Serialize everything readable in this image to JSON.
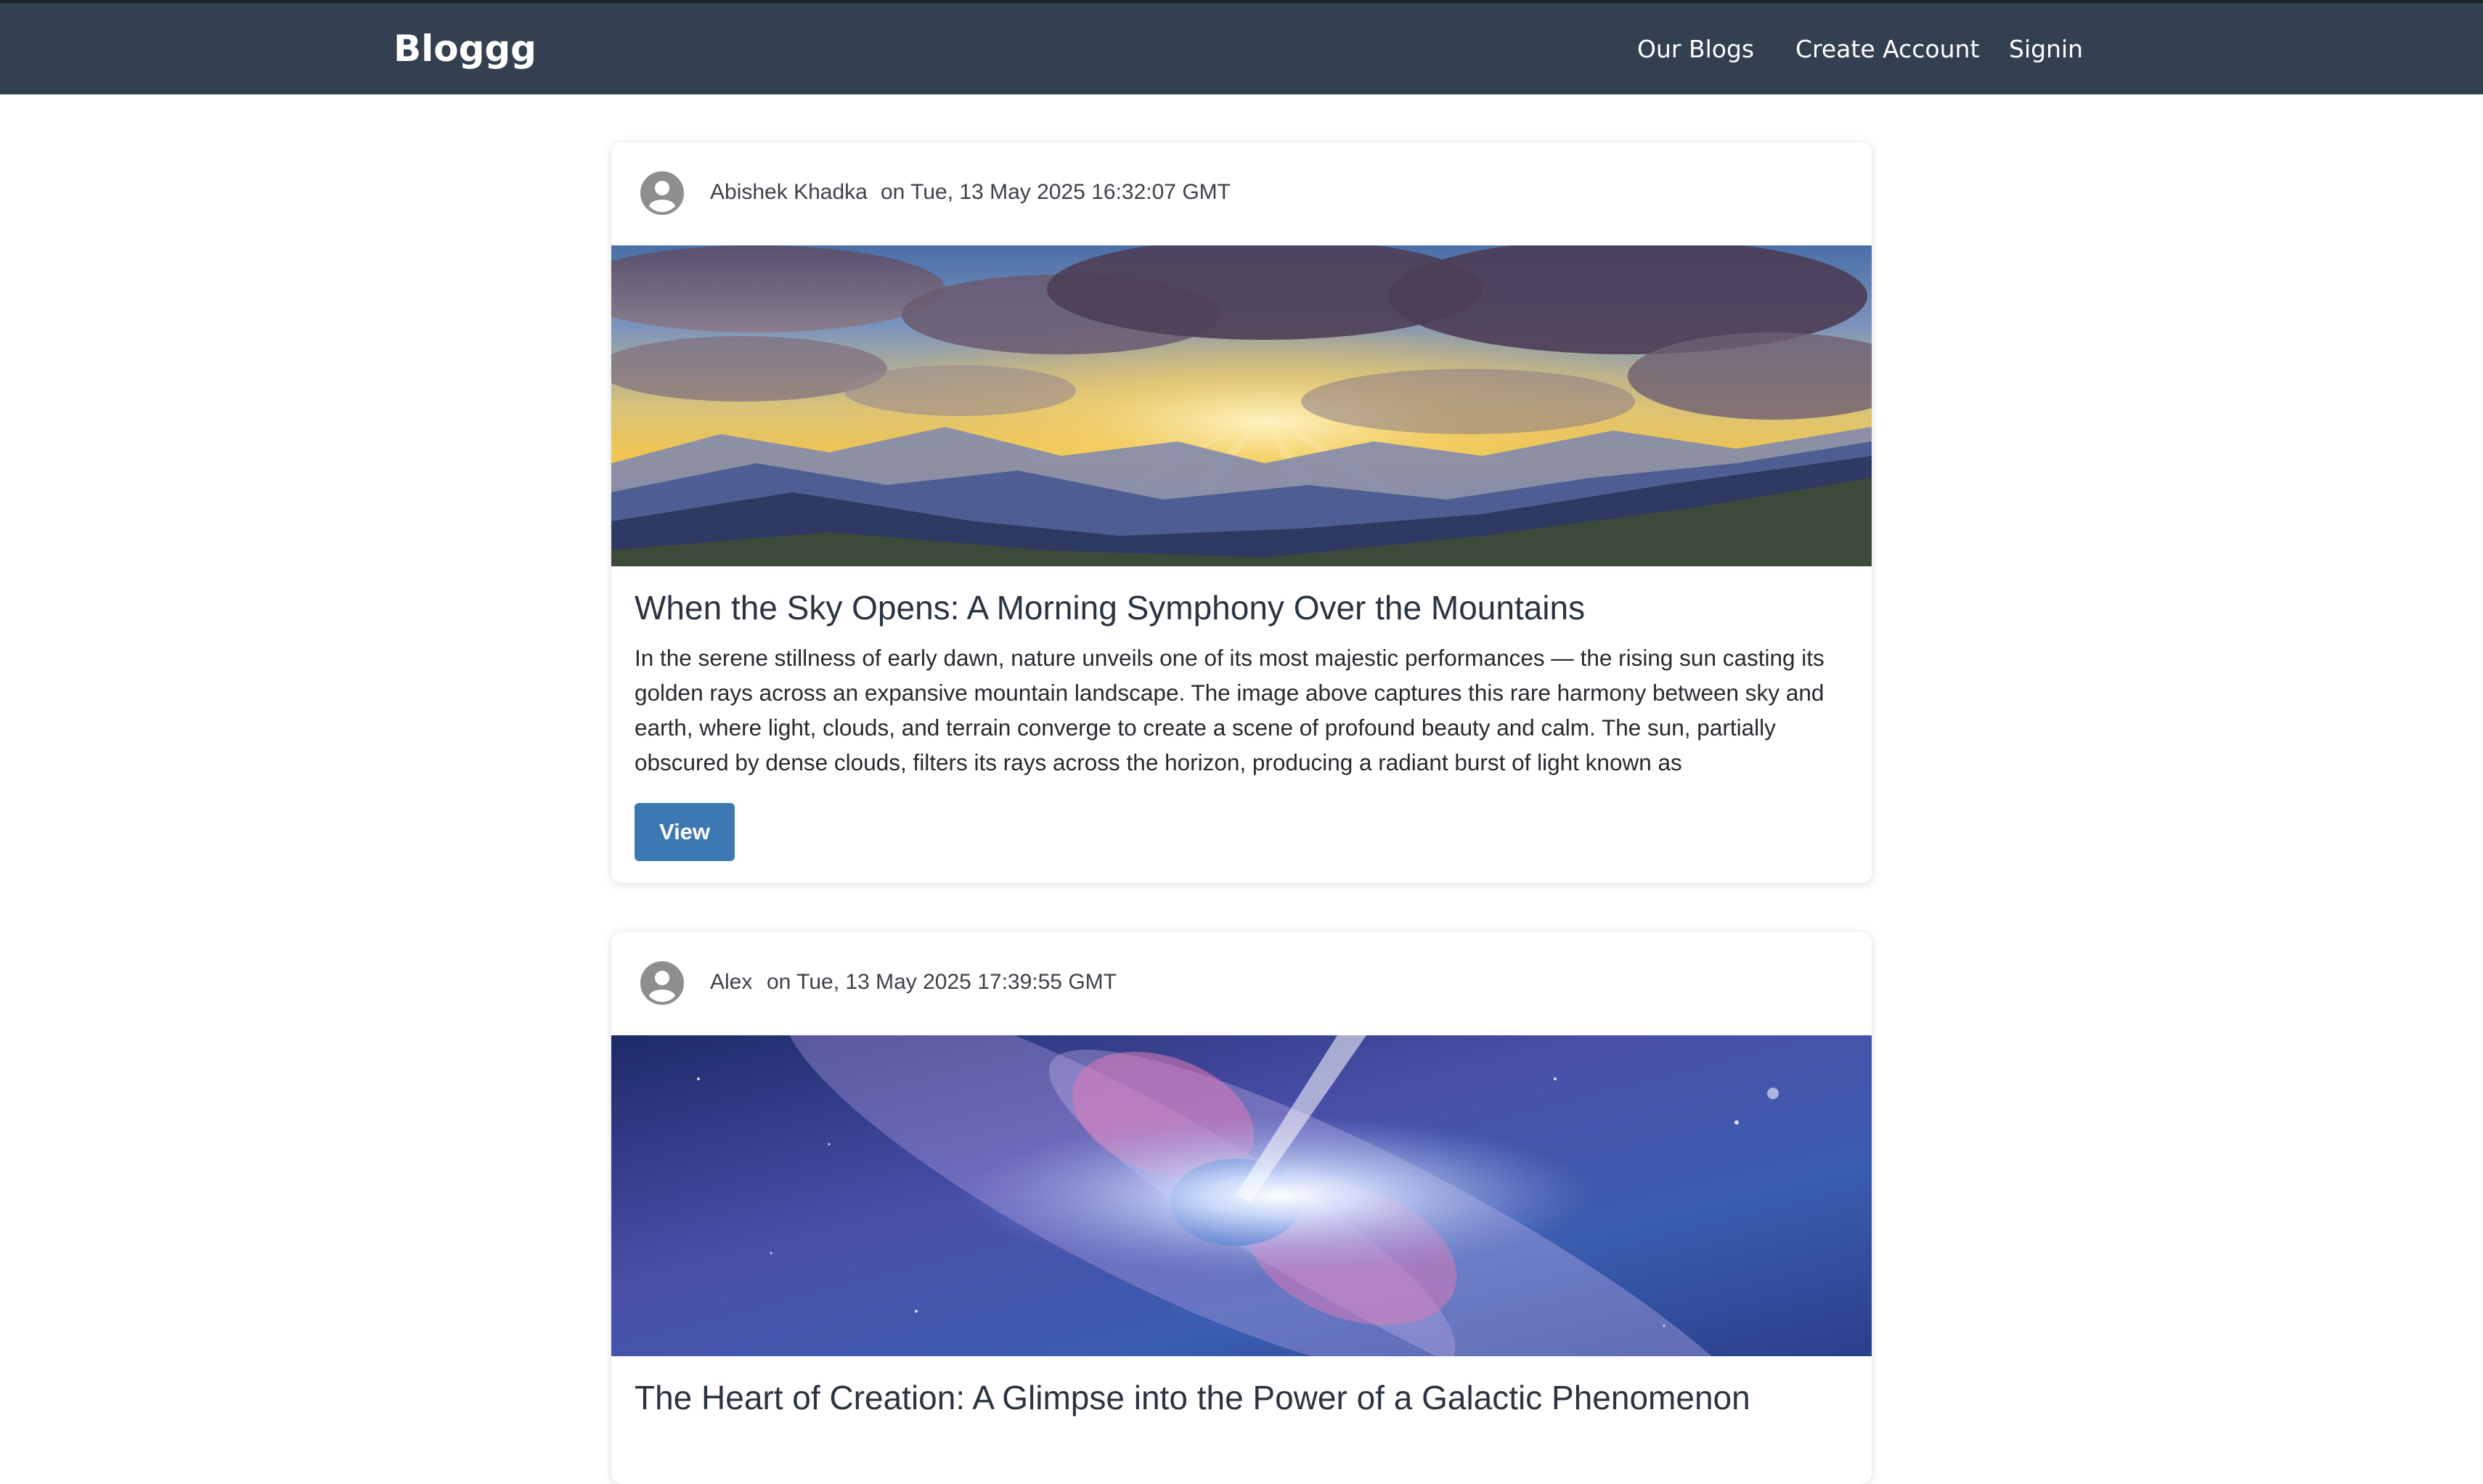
{
  "app": {
    "brand": "Bloggg"
  },
  "nav": {
    "our_blogs": "Our Blogs",
    "create_account": "Create Account",
    "signin": "Signin"
  },
  "posts": [
    {
      "author": "Abishek Khadka",
      "date": "on Tue, 13 May 2025 16:32:07 GMT",
      "title": "When the Sky Opens: A Morning Symphony Over the Mountains",
      "excerpt": "In the serene stillness of early dawn, nature unveils one of its most majestic performances — the rising sun casting its golden rays across an expansive mountain landscape. The image above captures this rare harmony between sky and earth, where light, clouds, and terrain converge to create a scene of profound beauty and calm. The sun, partially obscured by dense clouds, filters its rays across the horizon, producing a radiant burst of light known as",
      "button": "View",
      "image": "mountain-sunrise-image"
    },
    {
      "author": "Alex",
      "date": "on Tue, 13 May 2025 17:39:55 GMT",
      "title": "The Heart of Creation: A Glimpse into the Power of a Galactic Phenomenon",
      "image": "galaxy-nebula-image"
    }
  ],
  "icons": {
    "avatar": "user-avatar-icon"
  },
  "colors": {
    "navbar": "#334050",
    "accent": "#3e78b2",
    "title": "#2a3441"
  }
}
